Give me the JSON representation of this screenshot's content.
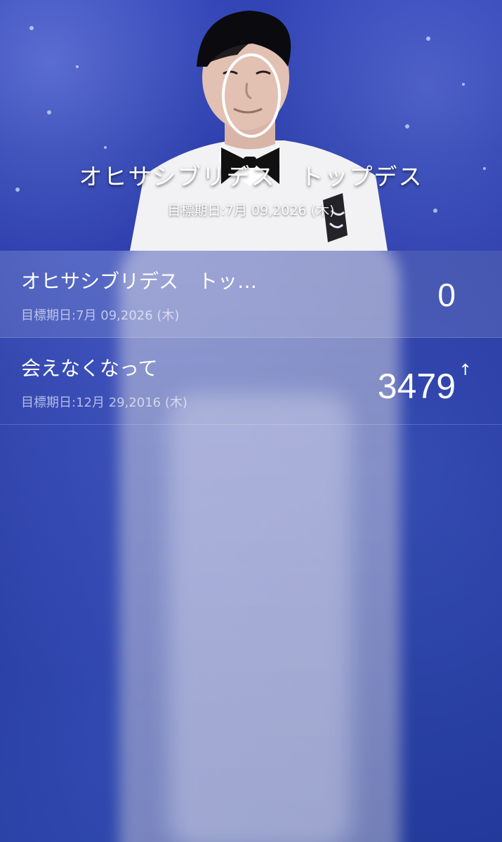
{
  "header": {
    "title": "オヒサシブリデス　トップデス",
    "subtitle": "目標期日:7月 09,2026 (木)"
  },
  "list": [
    {
      "title": "オヒサシブリデス　トップデス",
      "date": "目標期日:7月 09,2026 (木)",
      "count": "0",
      "arrow": ""
    },
    {
      "title": "会えなくなって",
      "date": "目標期日:12月 29,2016 (木)",
      "count": "3479",
      "arrow": "↑"
    }
  ],
  "colors": {
    "bg_blue": "#2a3aa8",
    "text": "#ffffff"
  }
}
